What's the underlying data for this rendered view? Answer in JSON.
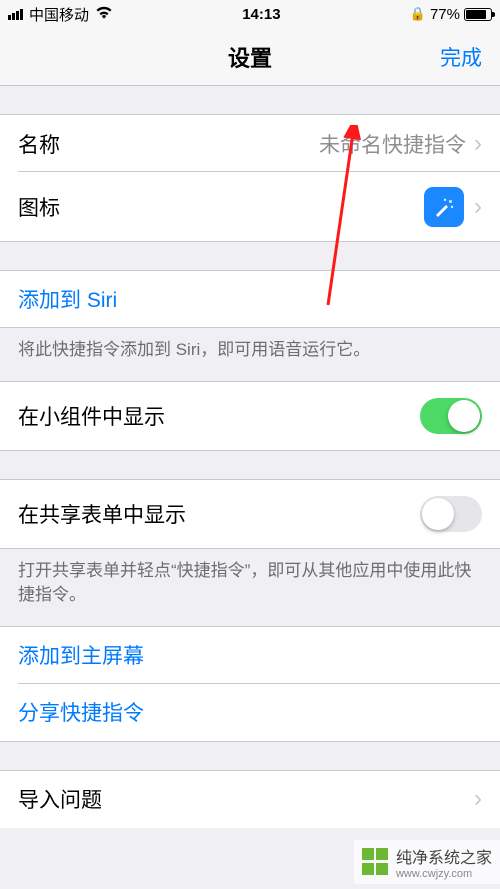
{
  "statusBar": {
    "carrier": "中国移动",
    "time": "14:13",
    "batteryPercent": "77%"
  },
  "header": {
    "title": "设置",
    "done": "完成"
  },
  "rows": {
    "name": {
      "label": "名称",
      "value": "未命名快捷指令"
    },
    "icon": {
      "label": "图标"
    },
    "addToSiri": {
      "label": "添加到 Siri"
    },
    "siriFooter": "将此快捷指令添加到 Siri，即可用语音运行它。",
    "showInWidget": {
      "label": "在小组件中显示"
    },
    "showInShareSheet": {
      "label": "在共享表单中显示"
    },
    "shareSheetFooter": "打开共享表单并轻点“快捷指令”，即可从其他应用中使用此快捷指令。",
    "addToHome": {
      "label": "添加到主屏幕"
    },
    "shareShortcut": {
      "label": "分享快捷指令"
    },
    "importQuestion": {
      "label": "导入问题"
    }
  },
  "watermark": {
    "name": "纯净系统之家",
    "url": "www.cwjzy.com"
  }
}
